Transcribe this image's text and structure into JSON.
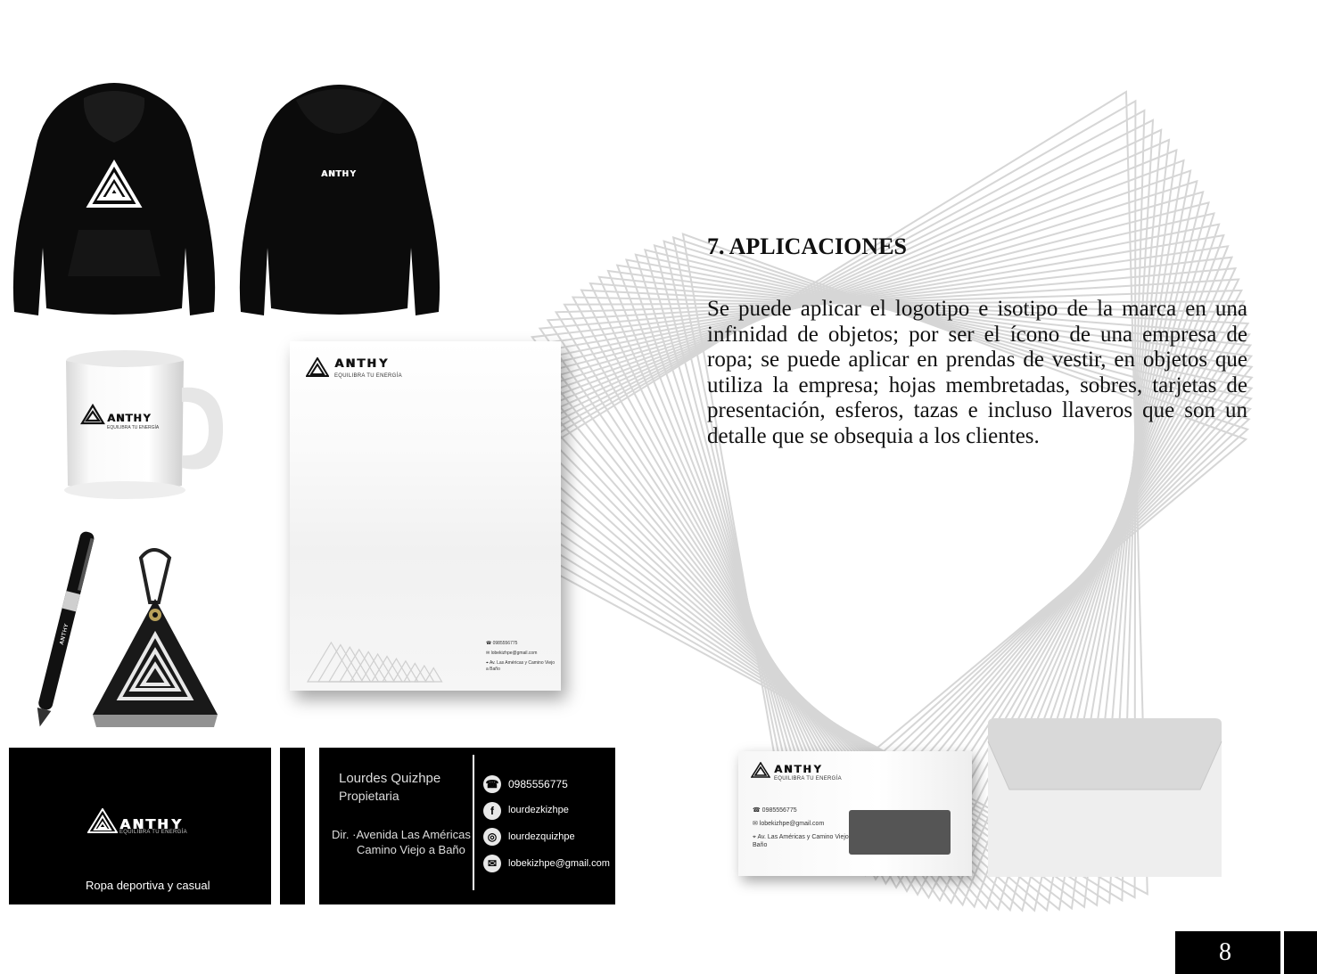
{
  "section": {
    "heading": "7. APLICACIONES",
    "body": "Se puede aplicar el logotipo e isotipo de la marca en una infinidad de objetos; por ser el ícono de una empresa de ropa; se puede aplicar en prendas de vestir, en objetos que utiliza la empresa; hojas membretadas, sobres, tarjetas de presentación, esferos, tazas e incluso llaveros que son un detalle que se obsequia a los clientes."
  },
  "brand": {
    "wordmark": "ᴀɴᴛʜʏ",
    "tagline": "EQUILIBRA TU ENERGÍA"
  },
  "letterhead": {
    "phone": "0985556775",
    "email": "lobekizhpe@gmail.com",
    "address": "Av. Las Américas y Camino Viejo a Baño"
  },
  "business_card_front": {
    "slogan": "Ropa deportiva y casual"
  },
  "business_card_back": {
    "name": "Lourdes Quizhpe",
    "role": "Propietaria",
    "address_line1": "Dir. ·Avenida Las Américas",
    "address_line2": "Camino Viejo a Baño",
    "phone": "0985556775",
    "facebook": "lourdezkizhpe",
    "instagram": "lourdezquizhpe",
    "email": "lobekizhpe@gmail.com"
  },
  "envelope": {
    "phone": "0985556775",
    "email": "lobekizhpe@gmail.com",
    "address": "Av. Las Américas y Camino Viejo a Baño"
  },
  "page_number": "8",
  "colors": {
    "brand_black": "#000000",
    "accent_gray": "#d9d9d9"
  }
}
